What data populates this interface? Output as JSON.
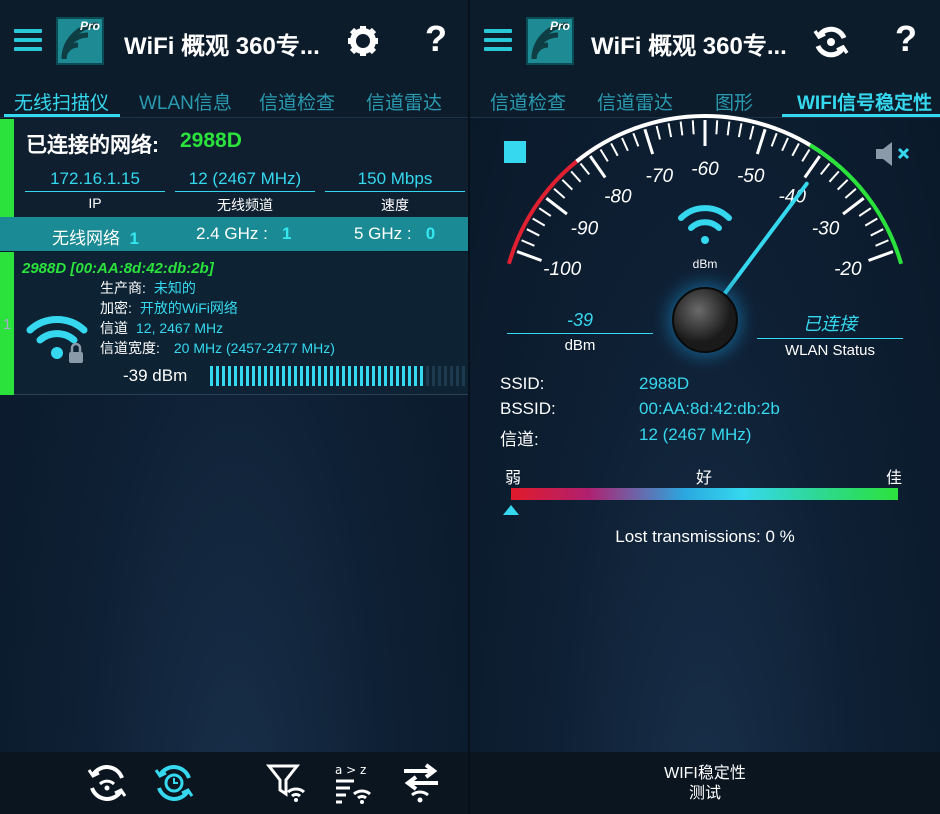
{
  "left": {
    "app_title": "WiFi 概观 360专...",
    "tabs": [
      "无线扫描仪",
      "WLAN信息",
      "信道检查",
      "信道雷达"
    ],
    "connected": {
      "label": "已连接的网络:",
      "ssid": "2988D",
      "ip_value": "172.16.1.15",
      "ip_label": "IP",
      "channel_value": "12 (2467 MHz)",
      "channel_label": "无线频道",
      "speed_value": "150 Mbps",
      "speed_label": "速度"
    },
    "netbar": {
      "wireless_label": "无线网络",
      "wireless_count": "1",
      "ghz24_label": "2.4 GHz :",
      "ghz24_count": "1",
      "ghz5_label": "5 GHz :",
      "ghz5_count": "0"
    },
    "network": {
      "index": "1",
      "title": "2988D [00:AA:8d:42:db:2b]",
      "vendor_label": "生产商:",
      "vendor_value": "未知的",
      "enc_label": "加密:",
      "enc_value": "开放的WiFi网络",
      "channel_label": "信道",
      "channel_value": "12, 2467 MHz",
      "width_label": "信道宽度:",
      "width_value": "20 MHz (2457-2477 MHz)",
      "dbm": "-39  dBm",
      "signal_fraction": 0.83
    },
    "bottom_icons": [
      "refresh-wifi-icon",
      "refresh-clock-icon",
      "filter-wifi-icon",
      "sort-az-icon",
      "swap-icon"
    ]
  },
  "right": {
    "app_title": "WiFi 概观 360专...",
    "tabs": [
      "信道检查",
      "信道雷达",
      "图形",
      "WIFI信号稳定性"
    ],
    "gauge": {
      "ticks": [
        "-100",
        "-90",
        "-80",
        "-70",
        "-60",
        "-50",
        "-40",
        "-30",
        "-20"
      ],
      "unit": "dBm",
      "value": -39
    },
    "dbm_value": "-39",
    "dbm_label": "dBm",
    "status_value": "已连接",
    "status_label": "WLAN Status",
    "ssid_label": "SSID:",
    "ssid_value": "2988D",
    "bssid_label": "BSSID:",
    "bssid_value": "00:AA:8d:42:db:2b",
    "channel_label": "信道:",
    "channel_value": "12 (2467 MHz)",
    "quality": {
      "weak": "弱",
      "good": "好",
      "best": "佳",
      "marker_fraction": 0.0
    },
    "lost": "Lost transmissions: 0 %",
    "bottom_button": [
      "WIFI稳定性",
      "测试"
    ]
  },
  "colors": {
    "accent": "#35d8ee",
    "green": "#2be23c",
    "teal_bar": "#1a8a94"
  }
}
